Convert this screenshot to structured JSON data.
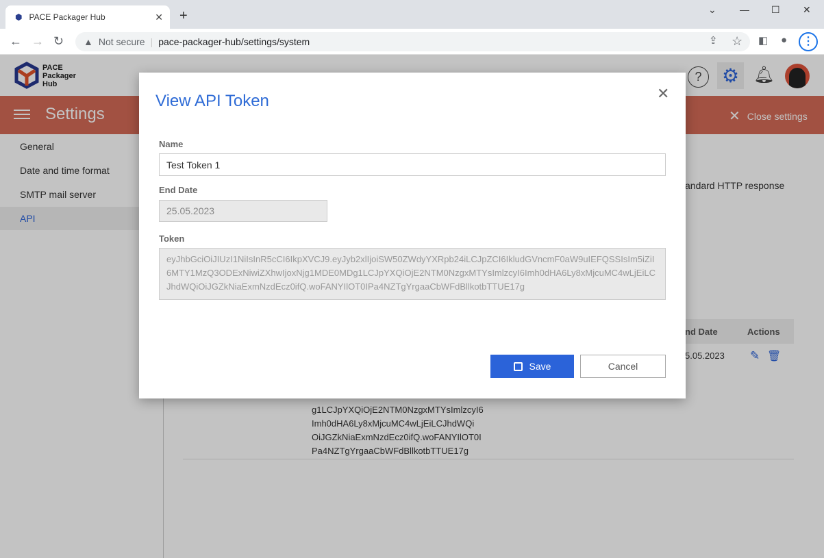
{
  "browser": {
    "tab_title": "PACE Packager Hub",
    "security": "Not secure",
    "url": "pace-packager-hub/settings/system"
  },
  "app": {
    "logo_lines": [
      "PACE",
      "Packager",
      "Hub"
    ],
    "section_title": "Settings",
    "close_settings": "Close settings"
  },
  "sidebar": {
    "items": [
      {
        "label": "General"
      },
      {
        "label": "Date and time format"
      },
      {
        "label": "SMTP mail server"
      },
      {
        "label": "API",
        "selected": true
      }
    ]
  },
  "background": {
    "description_fragment": "andard HTTP response",
    "table": {
      "headers": [
        "nd Date",
        "Actions"
      ],
      "row_date": "5.05.2023"
    },
    "token_lines": [
      "g1LCJpYXQiOjE2NTM0NzgxMTYsImlzcyI6",
      "Imh0dHA6Ly8xMjcuMC4wLjEiLCJhdWQi",
      "OiJGZkNiaExmNzdEcz0ifQ.woFANYIlOT0I",
      "Pa4NZTgYrgaaCbWFdBllkotbTTUE17g"
    ]
  },
  "modal": {
    "title": "View API Token",
    "name_label": "Name",
    "name_value": "Test Token 1",
    "end_date_label": "End Date",
    "end_date_value": "25.05.2023",
    "token_label": "Token",
    "token_value": "eyJhbGciOiJIUzI1NiIsInR5cCI6IkpXVCJ9.eyJyb2xlIjoiSW50ZWdyYXRpb24iLCJpZCI6IkludGVncmF0aW9uIEFQSSIsIm5iZiI6MTY1MzQ3ODExNiwiZXhwIjoxNjg1MDE0MDg1LCJpYXQiOjE2NTM0NzgxMTYsImlzcyI6Imh0dHA6Ly8xMjcuMC4wLjEiLCJhdWQiOiJGZkNiaExmNzdEcz0ifQ.woFANYIlOT0IPa4NZTgYrgaaCbWFdBllkotbTTUE17g",
    "save": "Save",
    "cancel": "Cancel"
  },
  "colors": {
    "accent": "#2b63d9",
    "settings_bar": "#d46b57",
    "title": "#2e6bd6"
  }
}
